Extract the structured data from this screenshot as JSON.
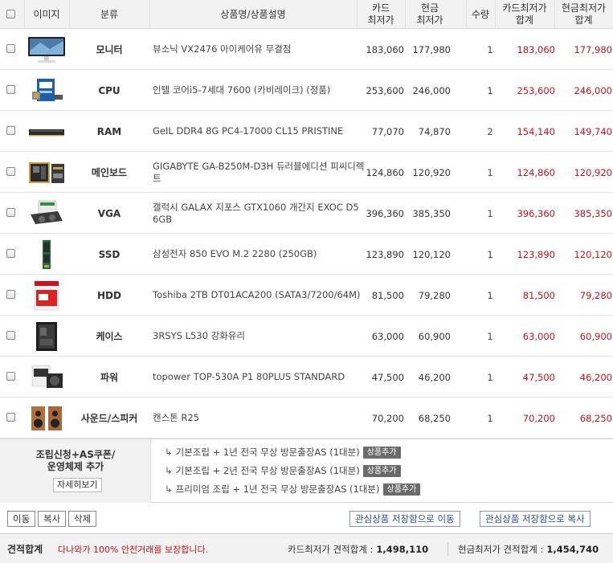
{
  "header": {
    "image": "이미지",
    "category": "분류",
    "product": "상품명/상품설명",
    "card_price": "카드\n최저가",
    "cash_price": "현금\n최저가",
    "qty": "수량",
    "card_sum": "카드최저가\n합계",
    "cash_sum": "현금최저가\n합계"
  },
  "rows": [
    {
      "category": "모니터",
      "name": "뷰소닉 VX2476 아이케어유 무결점",
      "card": "183,060",
      "cash": "177,980",
      "qty": "1",
      "card_sum": "183,060",
      "cash_sum": "177,980",
      "thumb": "monitor"
    },
    {
      "category": "CPU",
      "name": "인텔 코어i5-7세대 7600 (카비레이크) (정품)",
      "card": "253,600",
      "cash": "246,000",
      "qty": "1",
      "card_sum": "253,600",
      "cash_sum": "246,000",
      "thumb": "cpu"
    },
    {
      "category": "RAM",
      "name": "GeIL DDR4 8G PC4-17000 CL15 PRISTINE",
      "card": "77,070",
      "cash": "74,870",
      "qty": "2",
      "card_sum": "154,140",
      "cash_sum": "149,740",
      "thumb": "ram"
    },
    {
      "category": "메인보드",
      "name": "GIGABYTE GA-B250M-D3H 듀러블에디션 피씨디렉트",
      "card": "124,860",
      "cash": "120,920",
      "qty": "1",
      "card_sum": "124,860",
      "cash_sum": "120,920",
      "thumb": "board"
    },
    {
      "category": "VGA",
      "name": "갤럭시 GALAX 지포스 GTX1060 개간지 EXOC D5 6GB",
      "card": "396,360",
      "cash": "385,350",
      "qty": "1",
      "card_sum": "396,360",
      "cash_sum": "385,350",
      "thumb": "vga"
    },
    {
      "category": "SSD",
      "name": "삼성전자 850 EVO M.2 2280 (250GB)",
      "card": "123,890",
      "cash": "120,120",
      "qty": "1",
      "card_sum": "123,890",
      "cash_sum": "120,120",
      "thumb": "ssd"
    },
    {
      "category": "HDD",
      "name": "Toshiba 2TB DT01ACA200 (SATA3/7200/64M)",
      "card": "81,500",
      "cash": "79,280",
      "qty": "1",
      "card_sum": "81,500",
      "cash_sum": "79,280",
      "thumb": "hdd"
    },
    {
      "category": "케이스",
      "name": "3RSYS L530 강화유리",
      "card": "63,000",
      "cash": "60,900",
      "qty": "1",
      "card_sum": "63,000",
      "cash_sum": "60,900",
      "thumb": "case"
    },
    {
      "category": "파워",
      "name": "topower TOP-530A P1 80PLUS STANDARD",
      "card": "47,500",
      "cash": "46,200",
      "qty": "1",
      "card_sum": "47,500",
      "cash_sum": "46,200",
      "thumb": "psu"
    },
    {
      "category": "사운드/스피커",
      "name": "캔스톤 R25",
      "card": "70,200",
      "cash": "68,250",
      "qty": "1",
      "card_sum": "70,200",
      "cash_sum": "68,250",
      "thumb": "speaker"
    }
  ],
  "options": {
    "title": "조립신청+AS쿠폰/\n운영체제 추가",
    "detail_label": "자세히보기",
    "add_label": "상품추가",
    "mark": "↳",
    "lines": [
      "기본조립 + 1년 전국 무상 방문출장AS (1대분)",
      "기본조립 + 2년 전국 무상 방문출장AS (1대분)",
      "프리미엄 조립 + 1년 전국 무상 방문출장AS (1대분)"
    ]
  },
  "actions": {
    "move": "이동",
    "copy": "복사",
    "delete": "삭제",
    "save_move": "관심상품 저장함으로 이동",
    "save_copy": "관심상품 저장함으로 복사"
  },
  "totals": {
    "title": "견적합계",
    "notice": "다나와가 100% 안전거래를 보장합니다.",
    "card_label": "카드최저가 견적합계 :",
    "card_value": "1,498,110",
    "cash_label": "현금최저가 견적합계 :",
    "cash_value": "1,454,740"
  }
}
